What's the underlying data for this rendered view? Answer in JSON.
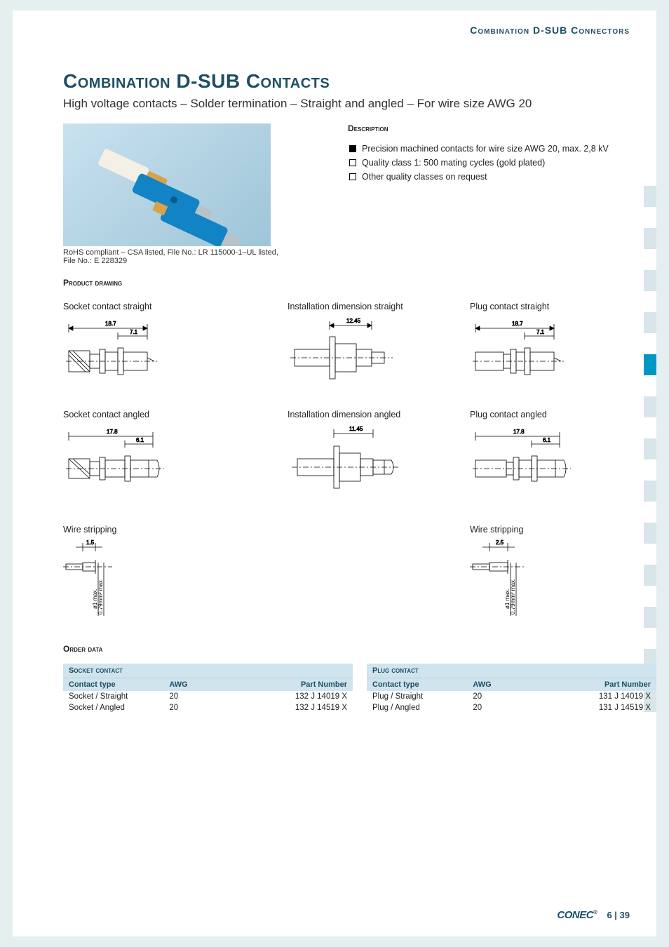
{
  "header": {
    "category": "Combination D-SUB Connectors"
  },
  "title": "Combination D-SUB Contacts",
  "subtitle": "High voltage contacts – Solder termination – Straight and angled – For wire size AWG 20",
  "photo_caption": "RoHS compliant – CSA listed, File No.: LR 115000-1–UL listed, File No.: E 228329",
  "description": {
    "heading": "Description",
    "items": [
      "Precision machined contacts for wire size AWG 20, max. 2,8 kV",
      "Quality class 1: 500 mating cycles (gold plated)",
      "Other quality classes on request"
    ]
  },
  "product_drawing": {
    "heading": "Product drawing",
    "labels": {
      "socket_straight": "Socket contact straight",
      "install_straight": "Installation dimension straight",
      "plug_straight": "Plug contact straight",
      "socket_angled": "Socket contact angled",
      "install_angled": "Installation dimension angled",
      "plug_angled": "Plug contact angled",
      "wire_stripping": "Wire stripping"
    },
    "dimensions": {
      "socket_straight": {
        "overall": "18.7",
        "front": "7.1"
      },
      "install_straight": {
        "dim": "12.45"
      },
      "plug_straight": {
        "overall": "18.7",
        "front": "7.1"
      },
      "socket_angled": {
        "overall": "17.8",
        "front": "6.1"
      },
      "install_angled": {
        "dim": "11.45"
      },
      "plug_angled": {
        "overall": "17.8",
        "front": "6.1"
      },
      "wire_strip_left": {
        "len": "1.5",
        "note1": "ø1 max.",
        "note2": "0.79mm² max."
      },
      "wire_strip_right": {
        "len": "2.5",
        "note1": "ø1 max.",
        "note2": "0.79mm² max."
      }
    }
  },
  "order_data": {
    "heading": "Order data",
    "socket": {
      "title": "Socket contact",
      "cols": [
        "Contact type",
        "AWG",
        "Part Number"
      ],
      "rows": [
        [
          "Socket / Straight",
          "20",
          "132 J 14019 X"
        ],
        [
          "Socket / Angled",
          "20",
          "132 J 14519 X"
        ]
      ]
    },
    "plug": {
      "title": "Plug contact",
      "cols": [
        "Contact type",
        "AWG",
        "Part Number"
      ],
      "rows": [
        [
          "Plug / Straight",
          "20",
          "131 J 14019 X"
        ],
        [
          "Plug / Angled",
          "20",
          "131 J 14519 X"
        ]
      ]
    }
  },
  "footer": {
    "logo": "CONEC",
    "page": "6 | 39"
  }
}
